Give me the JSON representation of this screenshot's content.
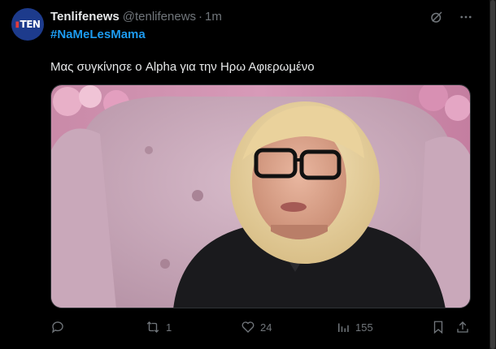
{
  "author": {
    "display_name": "Tenlifenews",
    "handle": "@tenlifenews",
    "separator": "·",
    "time": "1m",
    "avatar_icon": "tenlife-logo-avatar",
    "avatar_text_red": "▮",
    "avatar_text": "TEN"
  },
  "tweet": {
    "hashtag": "#NaMeLesMama",
    "text": "Μας συγκίνησε ο Alpha για την Ηρω Αφιερωμένο"
  },
  "top_icons": [
    "grok-icon",
    "more-icon"
  ],
  "media": {
    "description_icon": "video-still-image"
  },
  "actions": {
    "reply_count": "",
    "retweet_count": "1",
    "like_count": "24",
    "views_count": "155"
  },
  "colors": {
    "background": "#000000",
    "text": "#e7e9ea",
    "muted": "#71767b",
    "accent": "#1d9bf0"
  }
}
